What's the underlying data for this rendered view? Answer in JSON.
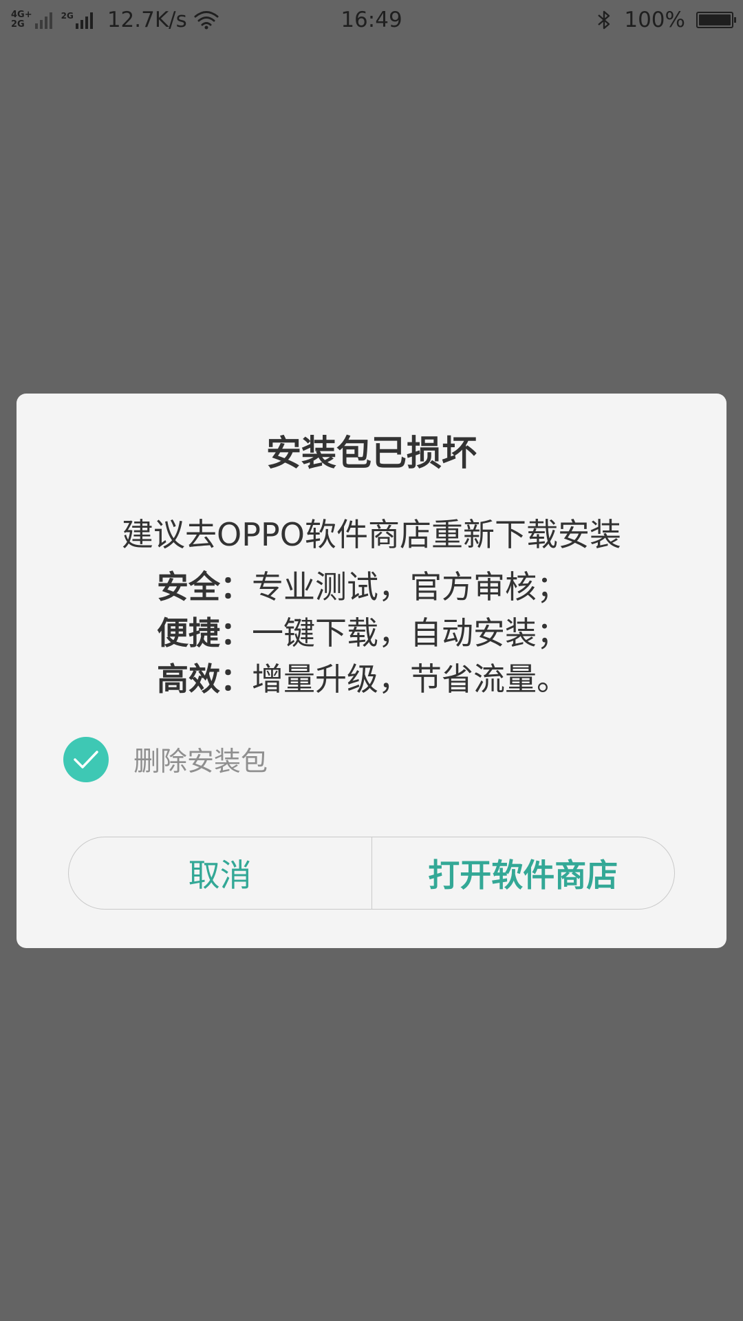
{
  "status_bar": {
    "sim1_network_top": "4G+",
    "sim1_network_bottom": "2G",
    "sim2_network": "2G",
    "net_speed": "12.7K/s",
    "time": "16:49",
    "battery_percent": "100%",
    "icons": [
      "signal-icon",
      "wifi-icon",
      "bluetooth-icon",
      "battery-icon"
    ]
  },
  "dialog": {
    "title": "安装包已损坏",
    "subtitle": "建议去OPPO软件商店重新下载安装",
    "features": [
      {
        "key": "安全：",
        "value": "专业测试，官方审核；"
      },
      {
        "key": "便捷：",
        "value": "一键下载，自动安装；"
      },
      {
        "key": "高效：",
        "value": "增量升级，节省流量。"
      }
    ],
    "checkbox": {
      "label": "删除安装包",
      "checked": true
    },
    "buttons": {
      "cancel_label": "取消",
      "confirm_label": "打开软件商店"
    }
  },
  "colors": {
    "overlay": "#646464",
    "dialog_bg": "#f4f4f4",
    "accent": "#33a896",
    "checkbox_fill": "#3ec8b4",
    "text_primary": "#333333",
    "text_secondary": "#8f8f8f"
  }
}
